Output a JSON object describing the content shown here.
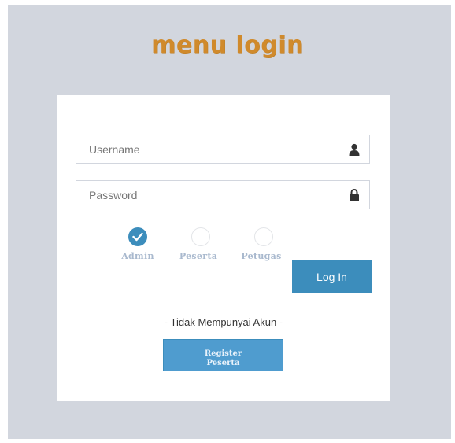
{
  "title": "menu login",
  "username": {
    "placeholder": "Username",
    "icon": "user-icon"
  },
  "password": {
    "placeholder": "Password",
    "icon": "lock-icon"
  },
  "roles": [
    {
      "label": "Admin",
      "checked": true
    },
    {
      "label": "Peserta",
      "checked": false
    },
    {
      "label": "Petugas",
      "checked": false
    }
  ],
  "login_button": "Log In",
  "no_account_text": "- Tidak Mempunyai Akun -",
  "register_button": "Register Peserta",
  "colors": {
    "background": "#d2d6de",
    "title": "#d08a2c",
    "primary": "#3c8dbc",
    "role_label": "#a9b9ce"
  }
}
